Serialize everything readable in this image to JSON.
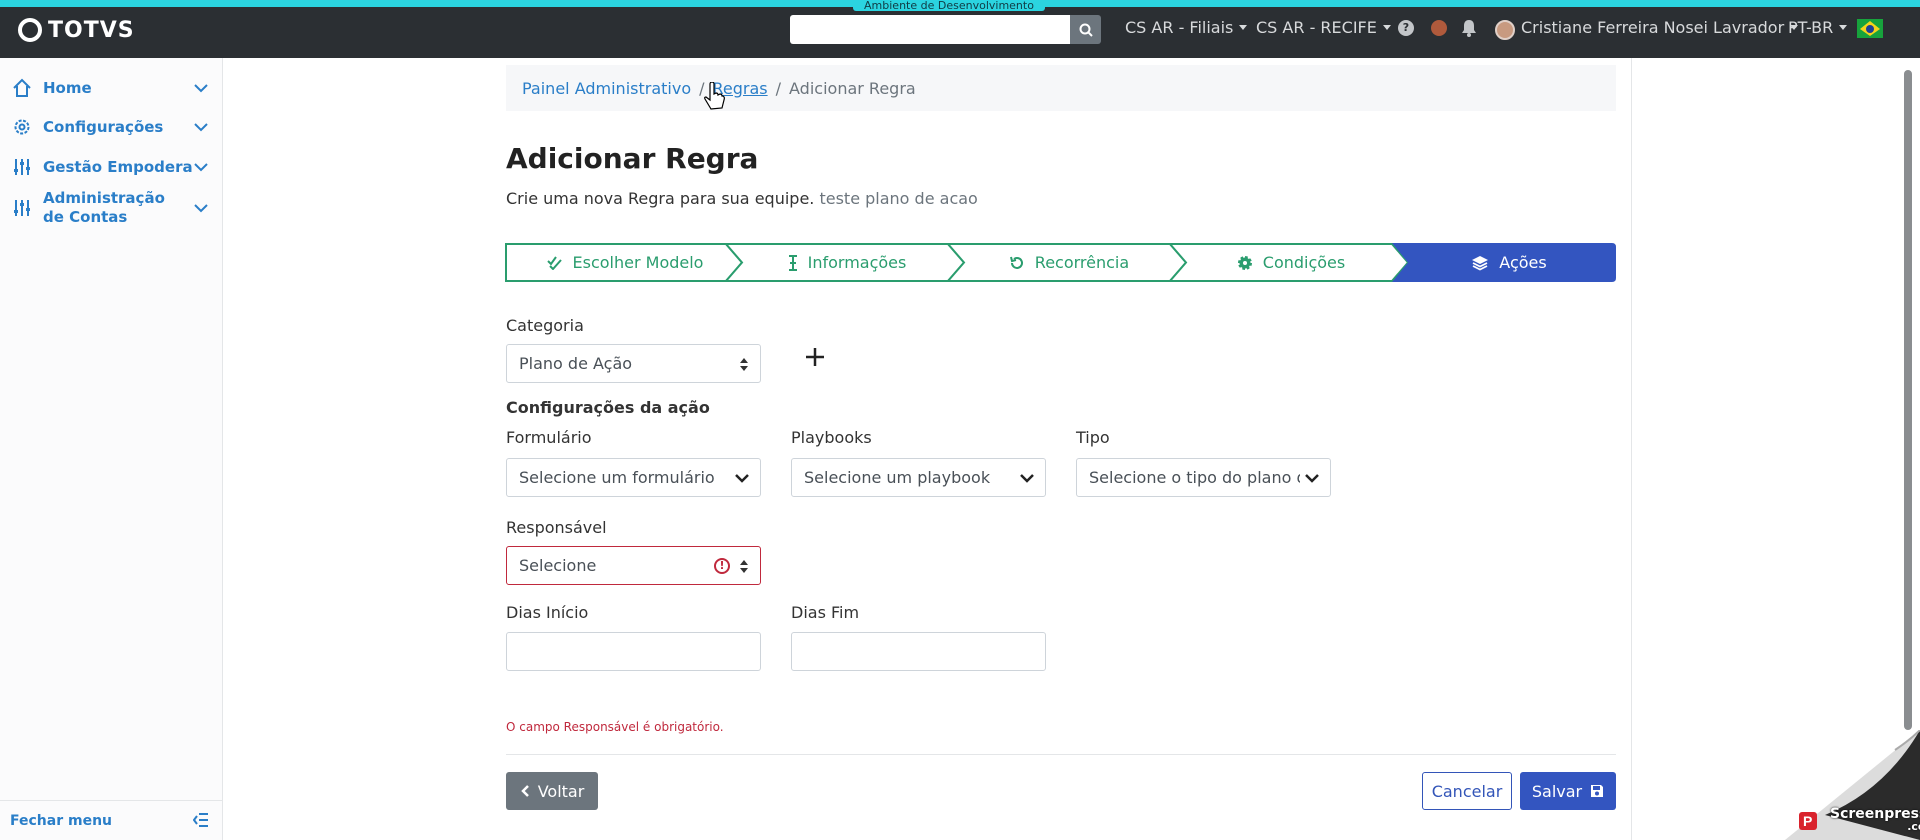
{
  "app": {
    "brand": "TOTVS",
    "env_tag": "Ambiente de Desenvolvimento",
    "accent_color": "#2bd4e0",
    "search": {
      "placeholder": "",
      "value": ""
    },
    "menus": [
      "CS AR - Filiais",
      "CS AR - RECIFE"
    ],
    "user_name": "Cristiane Ferreira Nosei Lavrador",
    "language": "PT-BR"
  },
  "sidebar": {
    "items": [
      {
        "label": "Home",
        "icon": "home-icon"
      },
      {
        "label": "Configurações",
        "icon": "gear-icon"
      },
      {
        "label": "Gestão Empodera",
        "icon": "sliders-icon"
      },
      {
        "label": "Administração de Contas",
        "icon": "sliders-icon"
      }
    ],
    "footer_label": "Fechar menu"
  },
  "breadcrumb": {
    "items": [
      "Painel Administrativo",
      "Regras",
      "Adicionar Regra"
    ]
  },
  "page": {
    "title": "Adicionar Regra",
    "subtitle": "Crie uma nova Regra para sua equipe.",
    "subtitle_extra": "teste plano de acao"
  },
  "stepper": {
    "steps": [
      {
        "label": "Escolher Modelo",
        "icon": "double-check-icon",
        "state": "done"
      },
      {
        "label": "Informações",
        "icon": "text-cursor-icon",
        "state": "done"
      },
      {
        "label": "Recorrência",
        "icon": "rotate-icon",
        "state": "done"
      },
      {
        "label": "Condições",
        "icon": "gear-icon",
        "state": "done"
      },
      {
        "label": "Ações",
        "icon": "layers-icon",
        "state": "active"
      }
    ],
    "done_color": "#2a9d6e",
    "active_color": "#3355c0"
  },
  "form": {
    "categoria_label": "Categoria",
    "categoria_value": "Plano de Ação",
    "section_title": "Configurações da ação",
    "formulario_label": "Formulário",
    "formulario_placeholder": "Selecione um formulário",
    "playbooks_label": "Playbooks",
    "playbooks_placeholder": "Selecione um playbook",
    "tipo_label": "Tipo",
    "tipo_placeholder": "Selecione o tipo do plano de a",
    "responsavel_label": "Responsável",
    "responsavel_value": "Selecione",
    "dias_inicio_label": "Dias Início",
    "dias_inicio_value": "",
    "dias_fim_label": "Dias Fim",
    "dias_fim_value": "",
    "error_message": "O campo Responsável é obrigatório."
  },
  "actions": {
    "back_label": "Voltar",
    "cancel_label": "Cancelar",
    "save_label": "Salvar"
  },
  "watermark": {
    "line1": "Screenpresso",
    "line2": ".com"
  }
}
